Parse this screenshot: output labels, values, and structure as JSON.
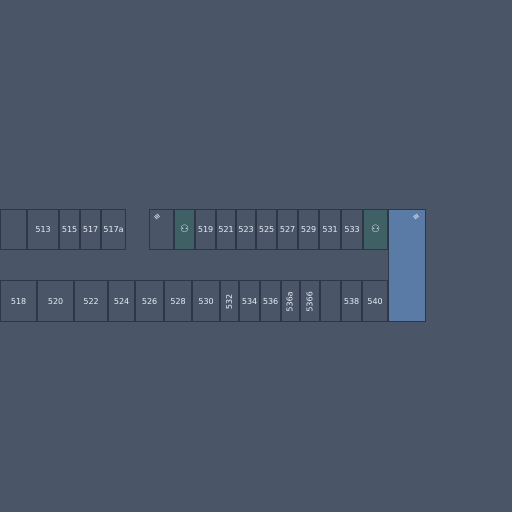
{
  "colors": {
    "background": "#4a5568",
    "room": "#4a5568",
    "restroom": "#3f6166",
    "elevator": "#5a7ba6",
    "border": "#2d3748",
    "label": "#e2e8f0"
  },
  "top_rooms": [
    {
      "label": ""
    },
    {
      "label": "513"
    },
    {
      "label": "515"
    },
    {
      "label": "517"
    },
    {
      "label": "517a"
    },
    {
      "label": "",
      "icon": "stairs-icon"
    },
    {
      "label": "",
      "type": "restroom",
      "icon": "restroom-icon"
    },
    {
      "label": "519"
    },
    {
      "label": "521"
    },
    {
      "label": "523"
    },
    {
      "label": "525"
    },
    {
      "label": "527"
    },
    {
      "label": "529"
    },
    {
      "label": "531"
    },
    {
      "label": "533"
    },
    {
      "label": "",
      "type": "restroom",
      "icon": "restroom-icon"
    }
  ],
  "bottom_rooms": [
    {
      "label": "518"
    },
    {
      "label": "520"
    },
    {
      "label": "522"
    },
    {
      "label": "524"
    },
    {
      "label": "526"
    },
    {
      "label": "528"
    },
    {
      "label": "530"
    },
    {
      "label": "532",
      "vertical": true
    },
    {
      "label": "534"
    },
    {
      "label": "536"
    },
    {
      "label": "536a",
      "vertical": true
    },
    {
      "label": "5366",
      "vertical": true
    },
    {
      "label": ""
    },
    {
      "label": "538"
    },
    {
      "label": "540"
    }
  ],
  "elevator_block": {
    "label": "",
    "type": "elevator",
    "icon": "stairs-icon"
  }
}
